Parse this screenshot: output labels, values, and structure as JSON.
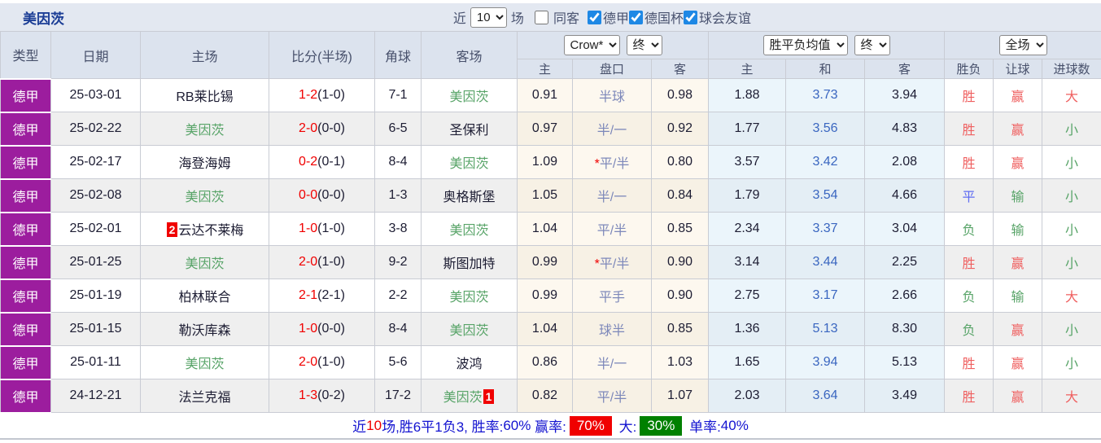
{
  "team": {
    "name": "美因茨"
  },
  "topbar": {
    "title": "美因茨",
    "recent_label": "近",
    "recent_count": "10",
    "matches_label": "场",
    "filters": [
      {
        "label": "同客",
        "checked": false
      },
      {
        "label": "德甲",
        "checked": true
      },
      {
        "label": "德国杯",
        "checked": true
      },
      {
        "label": "球会友谊",
        "checked": true
      }
    ]
  },
  "table": {
    "columns": [
      "类型",
      "日期",
      "主场",
      "比分(半场)",
      "角球",
      "客场"
    ],
    "sub_columns": [
      "主",
      "盘口",
      "客",
      "主",
      "和",
      "客",
      "胜负",
      "让球",
      "进球数"
    ],
    "groups": {
      "odds": {
        "company_select": "Crow*",
        "stage_select": "终"
      },
      "avg": {
        "type_select": "胜平负均值",
        "stage_select": "终"
      },
      "scope": {
        "scope_select": "全场"
      }
    },
    "rows": [
      {
        "league": "德甲",
        "date": "25-03-01",
        "home": "RB莱比锡",
        "home_badge": "",
        "score": "1-2",
        "half": "(1-0)",
        "corners": "7-1",
        "away": "美因茨",
        "away_badge": "",
        "odds_home": "0.91",
        "handicap": "半球",
        "odds_away": "0.98",
        "avg_home": "1.88",
        "avg_draw": "3.73",
        "avg_away": "3.94",
        "result": "胜",
        "handicap_result": "赢",
        "goals": "大"
      },
      {
        "league": "德甲",
        "date": "25-02-22",
        "home": "美因茨",
        "home_badge": "",
        "score": "2-0",
        "half": "(0-0)",
        "corners": "6-5",
        "away": "圣保利",
        "away_badge": "",
        "odds_home": "0.97",
        "handicap": "半/一",
        "odds_away": "0.92",
        "avg_home": "1.77",
        "avg_draw": "3.56",
        "avg_away": "4.83",
        "result": "胜",
        "handicap_result": "赢",
        "goals": "小"
      },
      {
        "league": "德甲",
        "date": "25-02-17",
        "home": "海登海姆",
        "home_badge": "",
        "score": "0-2",
        "half": "(0-1)",
        "corners": "8-4",
        "away": "美因茨",
        "away_badge": "",
        "odds_home": "1.09",
        "handicap": "*平/半",
        "odds_away": "0.80",
        "avg_home": "3.57",
        "avg_draw": "3.42",
        "avg_away": "2.08",
        "result": "胜",
        "handicap_result": "赢",
        "goals": "小"
      },
      {
        "league": "德甲",
        "date": "25-02-08",
        "home": "美因茨",
        "home_badge": "",
        "score": "0-0",
        "half": "(0-0)",
        "corners": "1-3",
        "away": "奥格斯堡",
        "away_badge": "",
        "odds_home": "1.05",
        "handicap": "半/一",
        "odds_away": "0.84",
        "avg_home": "1.79",
        "avg_draw": "3.54",
        "avg_away": "4.66",
        "result": "平",
        "handicap_result": "输",
        "goals": "小"
      },
      {
        "league": "德甲",
        "date": "25-02-01",
        "home": "云达不莱梅",
        "home_badge": "2",
        "score": "1-0",
        "half": "(1-0)",
        "corners": "3-8",
        "away": "美因茨",
        "away_badge": "",
        "odds_home": "1.04",
        "handicap": "平/半",
        "odds_away": "0.85",
        "avg_home": "2.34",
        "avg_draw": "3.37",
        "avg_away": "3.04",
        "result": "负",
        "handicap_result": "输",
        "goals": "小"
      },
      {
        "league": "德甲",
        "date": "25-01-25",
        "home": "美因茨",
        "home_badge": "",
        "score": "2-0",
        "half": "(1-0)",
        "corners": "9-2",
        "away": "斯图加特",
        "away_badge": "",
        "odds_home": "0.99",
        "handicap": "*平/半",
        "odds_away": "0.90",
        "avg_home": "3.14",
        "avg_draw": "3.44",
        "avg_away": "2.25",
        "result": "胜",
        "handicap_result": "赢",
        "goals": "小"
      },
      {
        "league": "德甲",
        "date": "25-01-19",
        "home": "柏林联合",
        "home_badge": "",
        "score": "2-1",
        "half": "(2-1)",
        "corners": "2-2",
        "away": "美因茨",
        "away_badge": "",
        "odds_home": "0.99",
        "handicap": "平手",
        "odds_away": "0.90",
        "avg_home": "2.75",
        "avg_draw": "3.17",
        "avg_away": "2.66",
        "result": "负",
        "handicap_result": "输",
        "goals": "大"
      },
      {
        "league": "德甲",
        "date": "25-01-15",
        "home": "勒沃库森",
        "home_badge": "",
        "score": "1-0",
        "half": "(0-0)",
        "corners": "8-4",
        "away": "美因茨",
        "away_badge": "",
        "odds_home": "1.04",
        "handicap": "球半",
        "odds_away": "0.85",
        "avg_home": "1.36",
        "avg_draw": "5.13",
        "avg_away": "8.30",
        "result": "负",
        "handicap_result": "赢",
        "goals": "小"
      },
      {
        "league": "德甲",
        "date": "25-01-11",
        "home": "美因茨",
        "home_badge": "",
        "score": "2-0",
        "half": "(1-0)",
        "corners": "5-6",
        "away": "波鸿",
        "away_badge": "",
        "odds_home": "0.86",
        "handicap": "半/一",
        "odds_away": "1.03",
        "avg_home": "1.65",
        "avg_draw": "3.94",
        "avg_away": "5.13",
        "result": "胜",
        "handicap_result": "赢",
        "goals": "小"
      },
      {
        "league": "德甲",
        "date": "24-12-21",
        "home": "法兰克福",
        "home_badge": "",
        "score": "1-3",
        "half": "(0-2)",
        "corners": "17-2",
        "away": "美因茨",
        "away_badge": "1",
        "odds_home": "0.82",
        "handicap": "平/半",
        "odds_away": "1.07",
        "avg_home": "2.03",
        "avg_draw": "3.64",
        "avg_away": "3.49",
        "result": "胜",
        "handicap_result": "赢",
        "goals": "大"
      }
    ]
  },
  "footer": {
    "segments": [
      {
        "text": "近",
        "style": "blue"
      },
      {
        "text": "10",
        "style": "red"
      },
      {
        "text": "场,胜6平1负3, 胜率:",
        "style": "blue"
      },
      {
        "text": "60%",
        "style": "blue"
      },
      {
        "text": " 赢率:",
        "style": "blue"
      },
      {
        "text": "70%",
        "style": "chip-red"
      },
      {
        "text": " 大:",
        "style": "blue"
      },
      {
        "text": "30%",
        "style": "chip-green"
      },
      {
        "text": " 单率:",
        "style": "blue"
      },
      {
        "text": "40%",
        "style": "blue"
      }
    ]
  },
  "colors": {
    "league_badge": "#9c1d9e",
    "checkbox_accent": "#1e88e5",
    "win_red": "#ef5f5f",
    "draw_blue": "#5f6cf2",
    "lose_green": "#58a468",
    "chip_red": "#f00000",
    "chip_green": "#008000"
  }
}
